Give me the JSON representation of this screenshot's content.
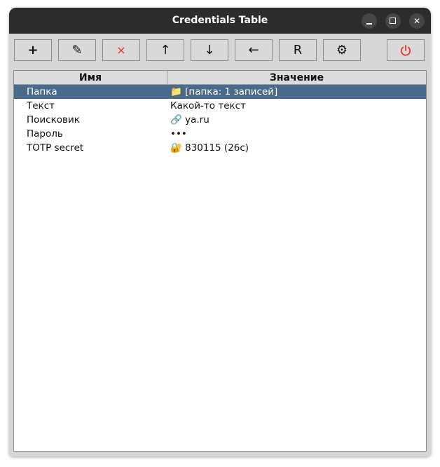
{
  "window": {
    "title": "Credentials Table"
  },
  "toolbar": {
    "buttons": [
      {
        "icon": "plus-icon",
        "glyph": "+"
      },
      {
        "icon": "pencil-icon",
        "glyph": "✎"
      },
      {
        "icon": "delete-icon",
        "glyph": "×"
      },
      {
        "icon": "arrow-up-icon",
        "glyph": "↑"
      },
      {
        "icon": "arrow-down-icon",
        "glyph": "↓"
      },
      {
        "icon": "arrow-left-icon",
        "glyph": "←"
      },
      {
        "icon": "letter-r-icon",
        "glyph": "R"
      },
      {
        "icon": "gear-icon",
        "glyph": "⚙"
      },
      {
        "icon": "power-icon",
        "glyph": "⏻"
      }
    ]
  },
  "table": {
    "headers": [
      "Имя",
      "Значение"
    ],
    "rows": [
      {
        "name": "Папка",
        "value": "📁 [папка: 1 записей]",
        "selected": true
      },
      {
        "name": "Текст",
        "value": "Какой-то текст",
        "selected": false
      },
      {
        "name": "Поисковик",
        "value": "🔗 ya.ru",
        "selected": false
      },
      {
        "name": "Пароль",
        "value": "•••",
        "selected": false
      },
      {
        "name": "TOTP secret",
        "value": "🔐 830115 (26с)",
        "selected": false
      }
    ]
  },
  "colors": {
    "titlebar": "#2c2c2c",
    "selection": "#4a6a8c",
    "danger": "#e8322e"
  }
}
